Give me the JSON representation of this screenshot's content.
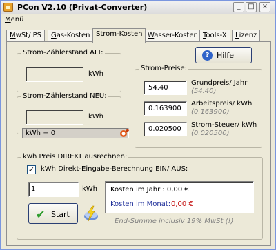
{
  "window": {
    "title": "PCon V2.10  (Privat-Converter)",
    "min": "_",
    "max": "□",
    "close": "×"
  },
  "menu": {
    "label_ul": "M",
    "label_rest": "enü"
  },
  "tabs": [
    {
      "ul": "M",
      "rest": "wSt/ PS"
    },
    {
      "ul": "G",
      "rest": "as-Kosten"
    },
    {
      "ul": "S",
      "rest": "trom-Kosten"
    },
    {
      "ul": "W",
      "rest": "asser-Kosten"
    },
    {
      "ul": "T",
      "rest": "ools-X"
    },
    {
      "ul": "L",
      "rest": "izenz"
    }
  ],
  "meter_old": {
    "legend": "Strom-Zählerstand ALT:",
    "value": "",
    "unit": "kWh"
  },
  "meter_new": {
    "legend": "Strom-Zählerstand NEU:",
    "value": "",
    "unit": "kWh"
  },
  "kwh_status": "kWh = 0",
  "help": {
    "ul": "H",
    "rest": "ilfe"
  },
  "prices": {
    "legend": "Strom-Preise:",
    "rows": [
      {
        "value": "54.40",
        "label": "Grundpreis/ Jahr",
        "default": "(54.40)"
      },
      {
        "value": "0.163900",
        "label": "Arbeitspreis/ kWh",
        "default": "(0.163900)"
      },
      {
        "value": "0.020500",
        "label": "Strom-Steuer/ kWh",
        "default": "(0.020500)"
      }
    ]
  },
  "direct": {
    "legend": "kwh Preis DIREKT ausrechnen:",
    "checkbox_checked": "✓",
    "checkbox_label": "kWh  Direkt-Eingabe-Berechnung EIN/ AUS:",
    "input_value": "1",
    "unit": "kWh",
    "start_ul": "S",
    "start_rest": "tart",
    "result_year": "Kosten im  Jahr  :  0,00  €",
    "result_month_label": "Kosten im Monat:",
    "result_month_value": "0,00  €",
    "footnote": "End-Summe inclusiv 19% MwSt (!)"
  },
  "colors": {
    "month_label": "#1f2f9a",
    "month_value": "#c00000",
    "accent": "#2f63c9"
  }
}
